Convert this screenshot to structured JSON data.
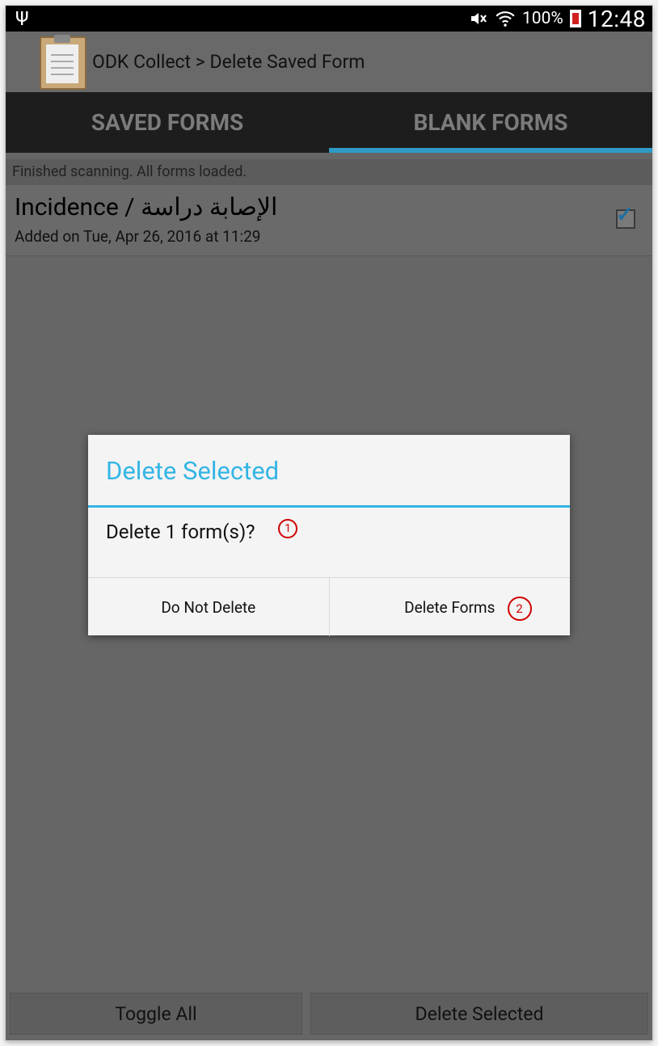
{
  "status_bar": {
    "usb_icon": "usb-icon",
    "mute_icon": "mute-icon",
    "wifi_icon": "wifi-icon",
    "battery_percent": "100%",
    "battery_icon": "battery-icon",
    "time": "12:48"
  },
  "action_bar": {
    "app_icon": "clipboard-icon",
    "title": "ODK Collect > Delete Saved Form"
  },
  "tabs": [
    {
      "label": "SAVED FORMS",
      "selected": false
    },
    {
      "label": "BLANK FORMS",
      "selected": true
    }
  ],
  "status_message": "Finished scanning. All forms loaded.",
  "form_list": [
    {
      "title": "Incidence / الإصابة دراسة",
      "subtitle": "Added on Tue, Apr 26, 2016 at 11:29",
      "checked": true
    }
  ],
  "dialog": {
    "title": "Delete Selected",
    "message": "Delete 1 form(s)?",
    "callout_1": "1",
    "cancel_label": "Do Not Delete",
    "confirm_label": "Delete Forms",
    "callout_2": "2"
  },
  "bottom_buttons": {
    "toggle_all": "Toggle All",
    "delete_selected": "Delete Selected"
  },
  "colors": {
    "accent": "#33b5e5",
    "tab_indicator": "#2e9ac6",
    "callout": "#d00000"
  }
}
